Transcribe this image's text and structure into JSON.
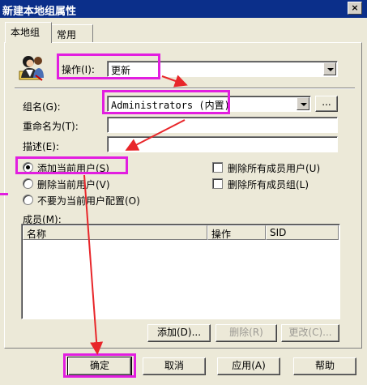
{
  "window": {
    "title": "新建本地组属性",
    "close_label": "×"
  },
  "tabs": [
    {
      "label": "本地组"
    },
    {
      "label": "常用"
    }
  ],
  "action": {
    "label": "操作(I):",
    "value": "更新"
  },
  "group_name": {
    "label": "组名(G):",
    "value": "Administrators (内置)",
    "browse_label": "..."
  },
  "rename": {
    "label": "重命名为(T):",
    "value": ""
  },
  "description": {
    "label": "描述(E):",
    "value": ""
  },
  "radios": [
    {
      "label": "添加当前用户(S)",
      "checked": true
    },
    {
      "label": "删除当前用户(V)",
      "checked": false
    },
    {
      "label": "不要为当前用户配置(O)",
      "checked": false
    }
  ],
  "checkboxes": [
    {
      "label": "删除所有成员用户(U)",
      "checked": false
    },
    {
      "label": "删除所有成员组(L)",
      "checked": false
    }
  ],
  "members": {
    "label": "成员(M):",
    "columns": [
      "名称",
      "操作",
      "SID"
    ],
    "rows": []
  },
  "member_buttons": {
    "add": "添加(D)...",
    "remove": "删除(R)",
    "change": "更改(C)..."
  },
  "footer": {
    "ok": "确定",
    "cancel": "取消",
    "apply": "应用(A)",
    "help": "帮助"
  },
  "colors": {
    "annotation": "#e21ee0",
    "arrow": "#e8262a",
    "title_bar": "#0b2f8a"
  }
}
